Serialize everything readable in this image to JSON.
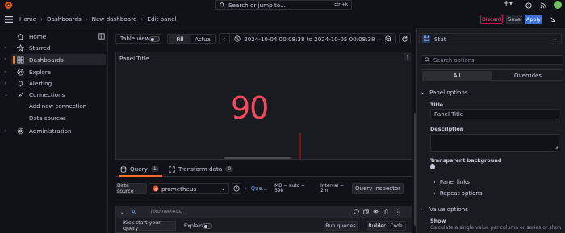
{
  "topbar": {
    "search_placeholder": "Search or jump to...",
    "shortcut": "ctrl+k",
    "plus": "+",
    "help_icon": "help-circle-icon",
    "news_icon": "rss-icon"
  },
  "breadcrumb": {
    "home": "Home",
    "dashboards": "Dashboards",
    "new_dashboard": "New dashboard",
    "edit_panel": "Edit panel"
  },
  "actions": {
    "discard": "Discard",
    "save": "Save",
    "apply": "Apply"
  },
  "colors": {
    "accent": "#3d71d9",
    "danger": "#d10e5c",
    "stat_red": "#f2495c",
    "orange": "#ff7c1f"
  },
  "sidebar": {
    "items": [
      {
        "label": "Home",
        "icon": "home-icon"
      },
      {
        "label": "Starred",
        "icon": "star-icon"
      },
      {
        "label": "Dashboards",
        "icon": "apps-icon"
      },
      {
        "label": "Explore",
        "icon": "compass-icon"
      },
      {
        "label": "Alerting",
        "icon": "bell-icon"
      },
      {
        "label": "Connections",
        "icon": "plug-icon"
      },
      {
        "label": "Add new connection"
      },
      {
        "label": "Data sources"
      },
      {
        "label": "Administration",
        "icon": "cog-icon"
      }
    ]
  },
  "toolbar": {
    "table_view": "Table view",
    "fill": "Fill",
    "actual": "Actual",
    "time_range": "2024-10-04 00:08:38 to 2024-10-05 00:08:38"
  },
  "panel": {
    "title": "Panel Title",
    "value": "90"
  },
  "query": {
    "tab_query": "Query",
    "query_count": "1",
    "tab_transform": "Transform data",
    "transform_count": "0",
    "data_source_label": "Data source",
    "data_source": "prometheus",
    "query_options": "Que...",
    "md_info": "MD = auto = 598",
    "interval_info": "Interval = 2m",
    "inspector": "Query inspector",
    "row_letter": "A",
    "row_ds": "(prometheus)",
    "kick_start": "Kick start your query",
    "explain": "Explain",
    "run_queries": "Run queries",
    "builder": "Builder",
    "code": "Code"
  },
  "options": {
    "viz": "Stat",
    "search_placeholder": "Search options",
    "tab_all": "All",
    "tab_overrides": "Overrides",
    "panel_options": "Panel options",
    "title_label": "Title",
    "title_value": "Panel Title",
    "description_label": "Description",
    "transparent_label": "Transparent background",
    "panel_links": "Panel links",
    "repeat_options": "Repeat options",
    "value_options": "Value options",
    "show_label": "Show",
    "show_desc": "Calculate a single value per column or series or show each row"
  }
}
